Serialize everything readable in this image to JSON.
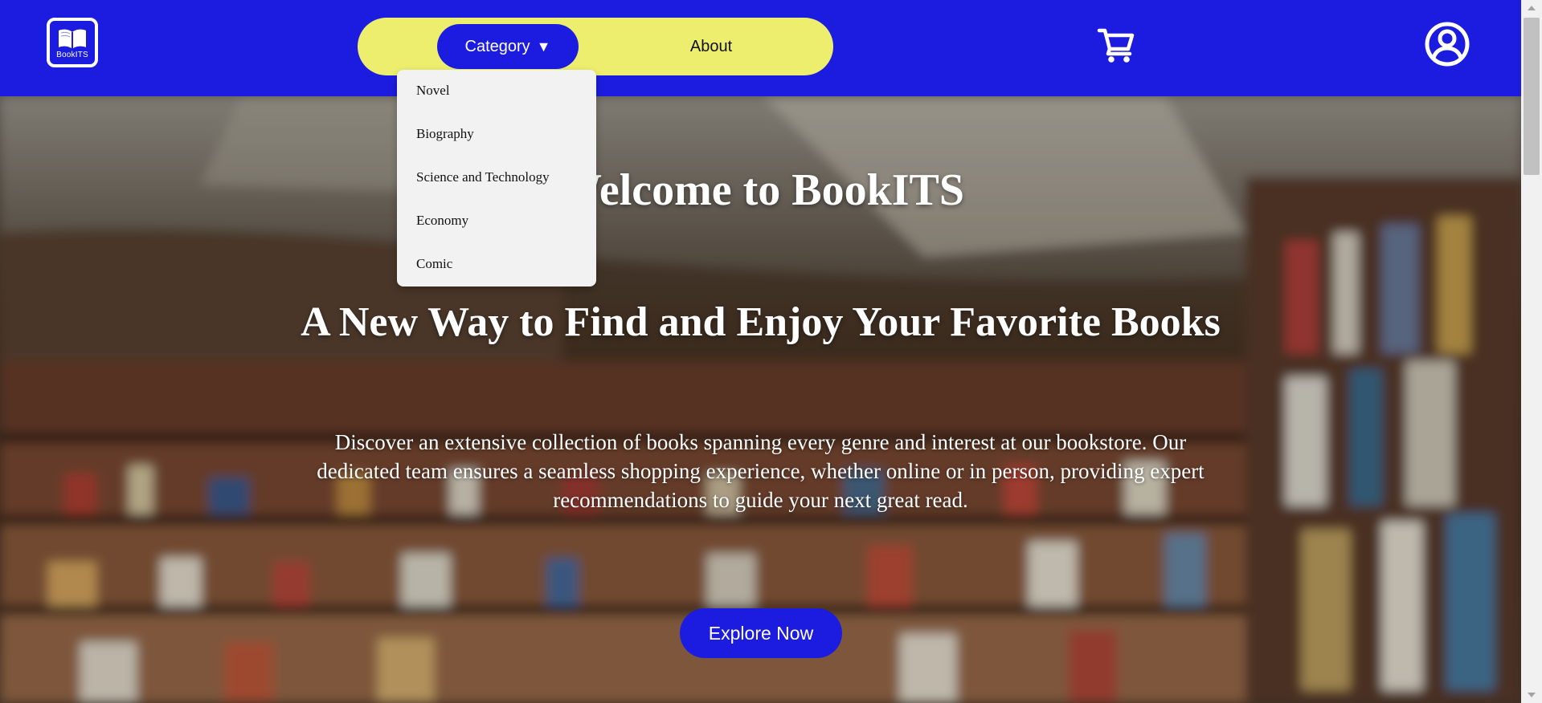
{
  "brand": {
    "logo_text": "BookITS",
    "logo_icon": "open-book-icon"
  },
  "nav": {
    "category_label": "Category",
    "category_caret": "▼",
    "about_label": "About",
    "cart_icon": "shopping-cart-icon",
    "account_icon": "user-circle-icon"
  },
  "dropdown": {
    "items": [
      "Novel",
      "Biography",
      "Science and Technology",
      "Economy",
      "Comic"
    ]
  },
  "hero": {
    "welcome": "Welcome to BookITS",
    "tagline": "A New Way to Find and Enjoy Your Favorite Books",
    "description": "Discover an extensive collection of books spanning every genre and interest at our bookstore. Our dedicated team ensures a seamless shopping experience, whether online or in person, providing expert recommendations to guide your next great read.",
    "cta_label": "Explore Now"
  },
  "colors": {
    "primary_blue": "#1c1ce0",
    "nav_yellow": "#eeee6e",
    "dropdown_bg": "#f2f2f2",
    "text_white": "#ffffff"
  }
}
